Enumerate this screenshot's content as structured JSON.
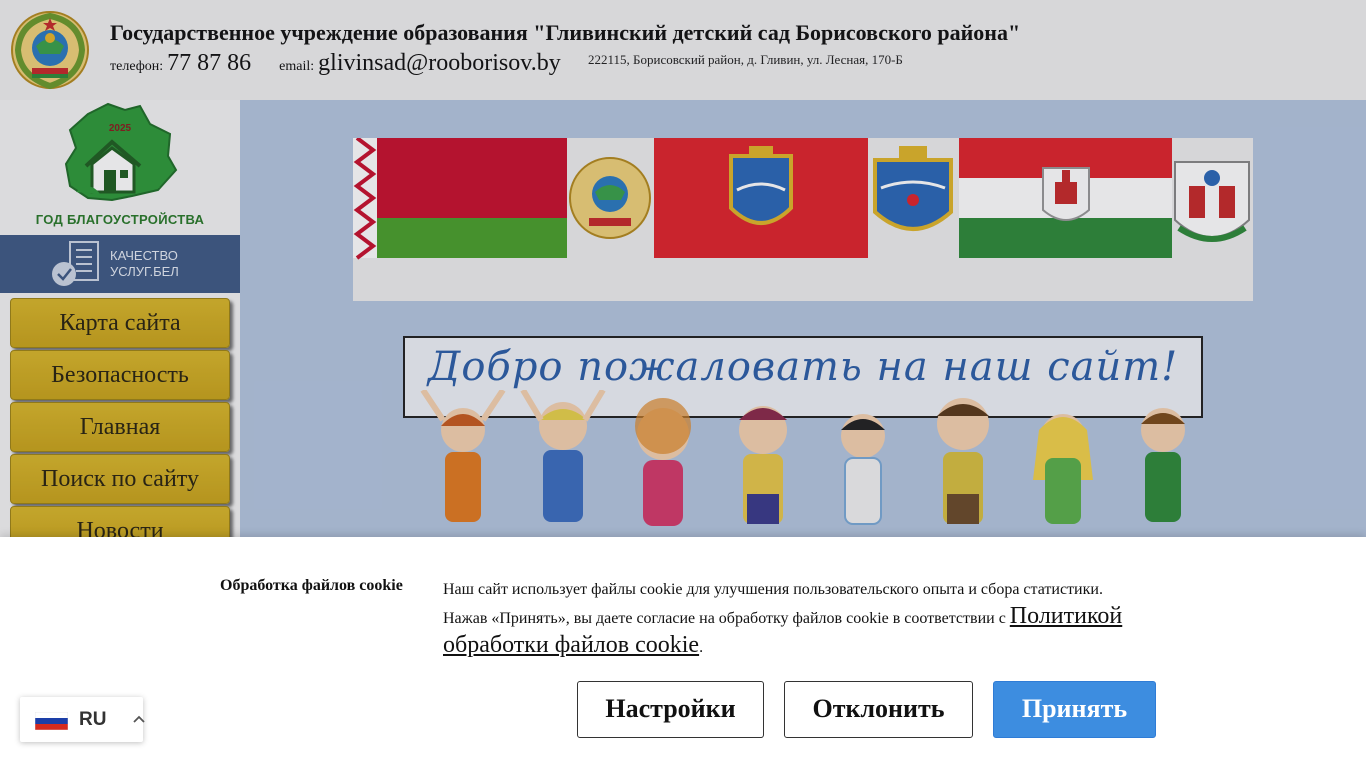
{
  "header": {
    "title": "Государственное учреждение образования \"Гливинский детский сад Борисовского района\"",
    "phone_label": "телефон:",
    "phone": "77 87 86",
    "email_label": "email:",
    "email": "glivinsad@rooborisov.by",
    "address": "222115, Борисовский район, д. Гливин, ул. Лесная, 170-Б"
  },
  "sidebar": {
    "year_badge": "2025",
    "year_caption": "ГОД БЛАГОУСТРОЙСТВА",
    "quality_line1": "КАЧЕСТВО",
    "quality_line2": "УСЛУГ.БЕЛ",
    "menu": [
      {
        "label": "Карта сайта"
      },
      {
        "label": "Безопасность"
      },
      {
        "label": "Главная"
      },
      {
        "label": "Поиск по сайту"
      },
      {
        "label": "Новости"
      }
    ]
  },
  "main": {
    "welcome": "Добро пожаловать на наш сайт!"
  },
  "cookie": {
    "title": "Обработка файлов cookie",
    "text1": "Наш сайт использует файлы cookie для улучшения пользовательского опыта и сбора статистики.",
    "text2": "Нажав «Принять», вы даете согласие на обработку файлов cookie в соответствии с",
    "policy_link": "Политикой обработки файлов cookie",
    "text_end": ".",
    "settings_label": "Настройки",
    "decline_label": "Отклонить",
    "accept_label": "Принять"
  },
  "language": {
    "code": "RU"
  },
  "colors": {
    "menu_gold": "#d2af24",
    "main_bg": "#b4c6e0",
    "quality_bg": "#3f5a86",
    "accept_blue": "#3d8de0",
    "welcome_blue": "#2d5fa8"
  },
  "icons": [
    "state-emblem-icon",
    "belarus-map-house-icon",
    "building-check-icon",
    "russia-flag-icon",
    "chevron-up-icon"
  ]
}
